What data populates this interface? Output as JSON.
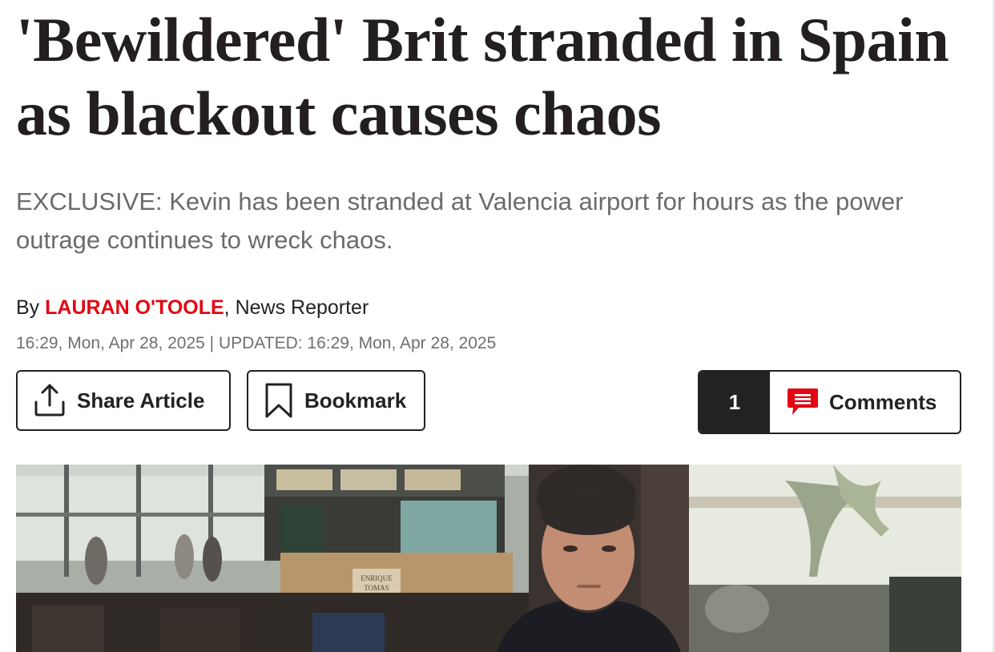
{
  "article": {
    "headline": "'Bewildered' Brit stranded in Spain as blackout causes chaos",
    "standfirst": "EXCLUSIVE: Kevin has been stranded at Valencia airport for hours as the power outrage continues to wreck chaos.",
    "byline": {
      "prefix": "By ",
      "author": "LAURAN O'TOOLE",
      "role": ", News Reporter"
    },
    "dateline": "16:29, Mon, Apr 28, 2025 | UPDATED: 16:29, Mon, Apr 28, 2025"
  },
  "actions": {
    "share": {
      "label": "Share Article",
      "icon": "share-upload-icon"
    },
    "bookmark": {
      "label": "Bookmark",
      "icon": "bookmark-icon"
    },
    "comments": {
      "count": "1",
      "label": "Comments",
      "icon": "comment-bubble-icon"
    }
  },
  "hero_image": {
    "sign_text_1": "ENRIQUE",
    "sign_text_2": "TOMAS"
  },
  "colors": {
    "author": "#e30613",
    "comment_icon": "#e30613",
    "headline": "#231f20",
    "standfirst": "#6b6b6b",
    "comment_count_bg": "#222222"
  }
}
